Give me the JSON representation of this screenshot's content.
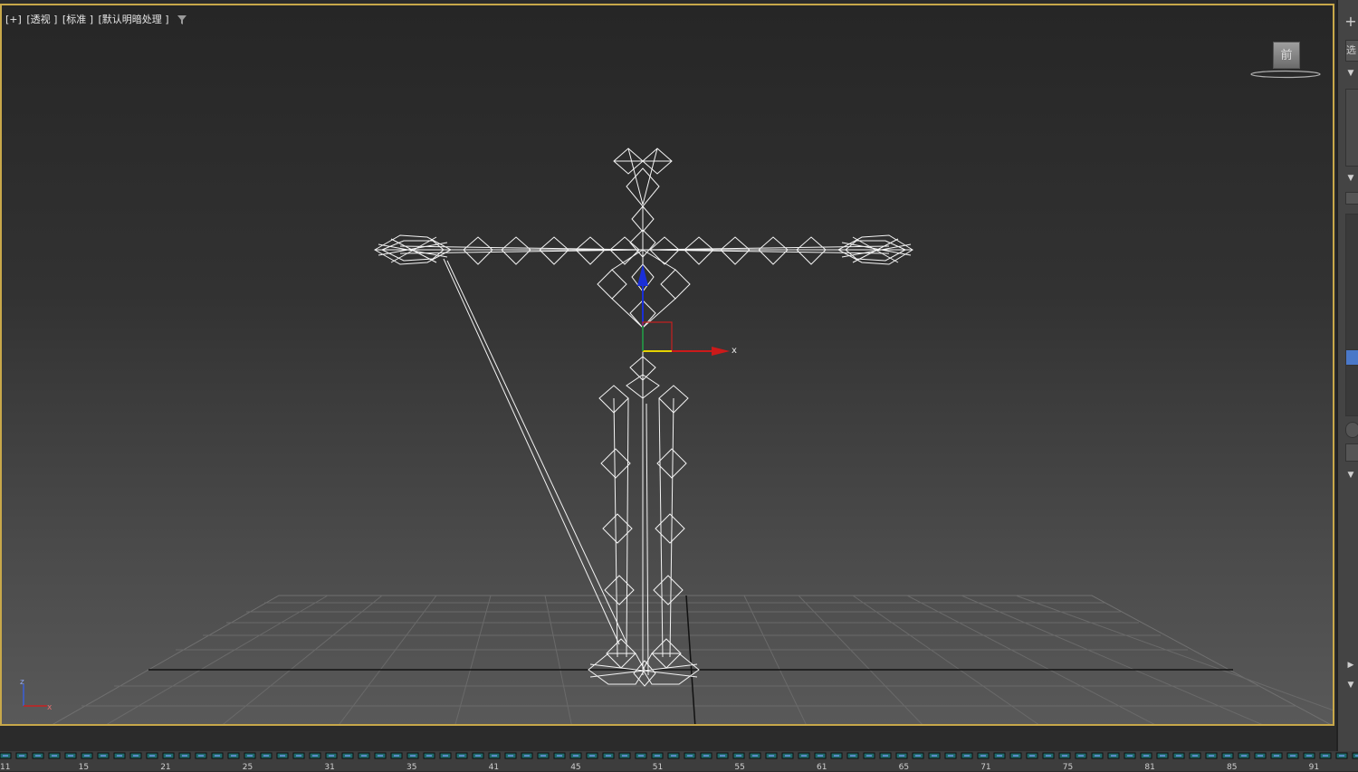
{
  "viewport": {
    "label_parts": [
      "[+]",
      "[透视 ]",
      "[标准 ]",
      "[默认明暗处理 ]"
    ],
    "viewcube_face": "前",
    "gizmo_axis_label": "x",
    "corner_axes": {
      "z": "z",
      "x": "x"
    },
    "border_color": "#c8a84a"
  },
  "icons": [
    "filter-icon",
    "plus-icon",
    "collapse-arrow-icon"
  ],
  "right_panel": {
    "plus": "+",
    "select_label": "选",
    "arrows": [
      "▼",
      "▼",
      "▼",
      "▶",
      "▼"
    ]
  },
  "timeline": {
    "ticks": [
      "11",
      "15",
      "21",
      "25",
      "31",
      "35",
      "41",
      "45",
      "51",
      "55",
      "61",
      "65",
      "71",
      "75",
      "81",
      "85",
      "91"
    ]
  }
}
